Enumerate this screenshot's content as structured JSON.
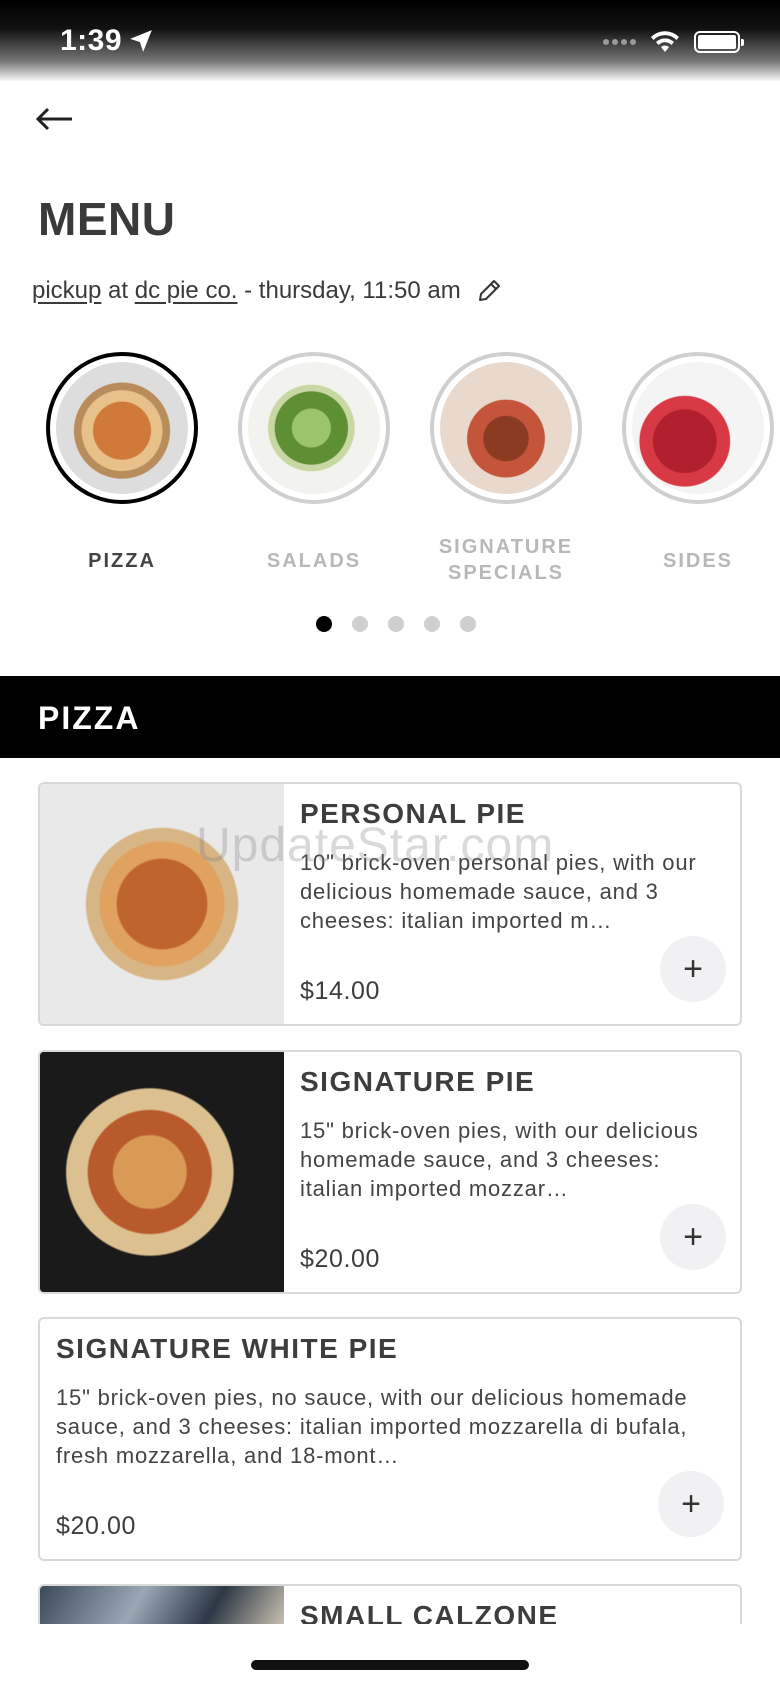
{
  "status_bar": {
    "time": "1:39"
  },
  "header": {
    "title": "MENU"
  },
  "order_info": {
    "mode": "pickup",
    "at": "at",
    "store": "dc pie co.",
    "when": "- thursday, 11:50 am"
  },
  "categories": [
    {
      "label": "PIZZA",
      "active": true,
      "icon": "pizza-photo"
    },
    {
      "label": "SALADS",
      "active": false,
      "icon": "salad-photo"
    },
    {
      "label": "SIGNATURE SPECIALS",
      "label_line1": "SIGNATURE",
      "label_line2": "SPECIALS",
      "active": false,
      "icon": "signature-special-photo"
    },
    {
      "label": "SIDES",
      "active": false,
      "icon": "sides-photo"
    }
  ],
  "pager": {
    "pages": 5,
    "current": 1
  },
  "section": {
    "title": "PIZZA"
  },
  "items": [
    {
      "name": "PERSONAL PIE",
      "description": "10\" brick-oven personal pies, with our delicious homemade sauce, and 3 cheeses: italian imported m…",
      "price": "$14.00",
      "add_label": "+"
    },
    {
      "name": "SIGNATURE PIE",
      "description": "15\" brick-oven pies, with our delicious homemade sauce, and 3 cheeses: italian imported mozzar…",
      "price": "$20.00",
      "add_label": "+"
    },
    {
      "name": "SIGNATURE WHITE PIE",
      "description": "15\" brick-oven pies, no sauce, with our delicious homemade sauce, and 3 cheeses: italian imported mozzarella di bufala, fresh mozzarella, and 18-mont…",
      "price": "$20.00",
      "add_label": "+"
    },
    {
      "name": "SMALL CALZONE"
    }
  ],
  "watermark": "UpdateStar.com"
}
